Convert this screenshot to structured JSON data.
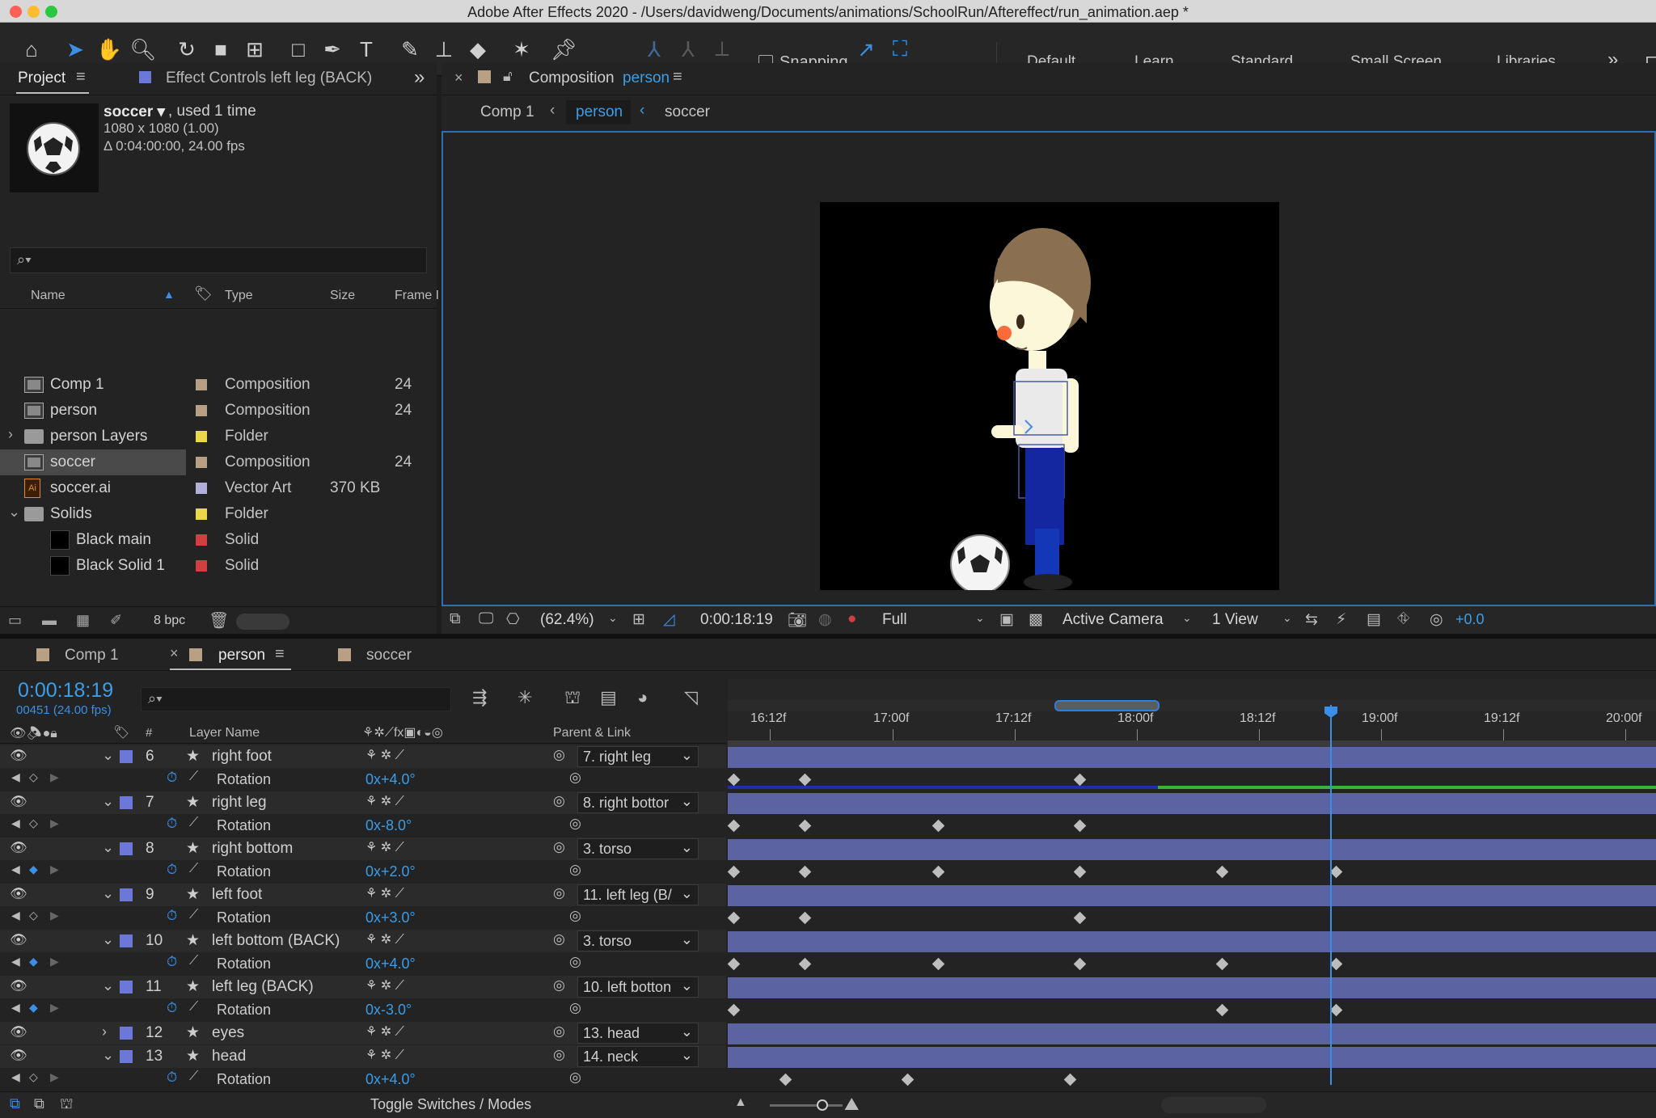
{
  "window": {
    "title": "Adobe After Effects 2020 - /Users/davidweng/Documents/animations/SchoolRun/Aftereffect/run_animation.aep *"
  },
  "toolbar": {
    "snapping_label": "Snapping",
    "workspaces": [
      "Default",
      "Learn",
      "Standard",
      "Small Screen",
      "Libraries"
    ]
  },
  "project_panel": {
    "tab_project": "Project",
    "tab_effect_controls": "Effect Controls left leg (BACK)",
    "preview": {
      "name": "soccer ▾",
      "used": ", used 1 time",
      "dims": "1080 x 1080 (1.00)",
      "duration": "Δ 0:04:00:00, 24.00 fps"
    },
    "search_placeholder": "",
    "columns": {
      "name": "Name",
      "type": "Type",
      "size": "Size",
      "frame": "Frame I"
    },
    "items": [
      {
        "name": "Comp 1",
        "type": "Composition",
        "size": "",
        "frame": "24",
        "color": "#b8a084"
      },
      {
        "name": "person",
        "type": "Composition",
        "size": "",
        "frame": "24",
        "color": "#b8a084"
      },
      {
        "name": "person Layers",
        "type": "Folder",
        "size": "",
        "frame": "",
        "color": "#e8d84a"
      },
      {
        "name": "soccer",
        "type": "Composition",
        "size": "",
        "frame": "24",
        "color": "#b8a084"
      },
      {
        "name": "soccer.ai",
        "type": "Vector Art",
        "size": "370 KB",
        "frame": "",
        "color": "#b0b0d8"
      },
      {
        "name": "Solids",
        "type": "Folder",
        "size": "",
        "frame": "",
        "color": "#e8d84a"
      },
      {
        "name": "Black main",
        "type": "Solid",
        "size": "",
        "frame": "",
        "color": "#d04040"
      },
      {
        "name": "Black Solid 1",
        "type": "Solid",
        "size": "",
        "frame": "",
        "color": "#d04040"
      }
    ],
    "bpc": "8 bpc"
  },
  "comp_panel": {
    "tab_prefix": "Composition",
    "tab_name": "person",
    "breadcrumbs": [
      "Comp 1",
      "person",
      "soccer"
    ],
    "zoom": "(62.4%)",
    "timecode": "0:00:18:19",
    "resolution": "Full",
    "camera": "Active Camera",
    "views": "1 View",
    "exposure": "+0.0"
  },
  "timeline": {
    "tabs": [
      "Comp 1",
      "person",
      "soccer"
    ],
    "timecode": "0:00:18:19",
    "frames": "00451 (24.00 fps)",
    "col_layer_name": "Layer Name",
    "col_parent": "Parent & Link",
    "ruler": [
      "16:12f",
      "17:00f",
      "17:12f",
      "18:00f",
      "18:12f",
      "19:00f",
      "19:12f",
      "20:00f"
    ],
    "toggle_label": "Toggle Switches / Modes",
    "layers": [
      {
        "num": "6",
        "name": "right foot",
        "parent": "7. right leg",
        "prop": "Rotation",
        "value": "0x+4.0°"
      },
      {
        "num": "7",
        "name": "right leg",
        "parent": "8. right bottor",
        "prop": "Rotation",
        "value": "0x-8.0°"
      },
      {
        "num": "8",
        "name": "right bottom",
        "parent": "3. torso",
        "prop": "Rotation",
        "value": "0x+2.0°"
      },
      {
        "num": "9",
        "name": "left foot",
        "parent": "11. left leg (B/",
        "prop": "Rotation",
        "value": "0x+3.0°"
      },
      {
        "num": "10",
        "name": "left bottom (BACK)",
        "parent": "3. torso",
        "prop": "Rotation",
        "value": "0x+4.0°"
      },
      {
        "num": "11",
        "name": "left leg (BACK)",
        "parent": "10. left botton",
        "prop": "Rotation",
        "value": "0x-3.0°"
      },
      {
        "num": "12",
        "name": "eyes",
        "parent": "13. head"
      },
      {
        "num": "13",
        "name": "head",
        "parent": "14. neck",
        "prop": "Rotation",
        "value": "0x+4.0°"
      }
    ]
  }
}
